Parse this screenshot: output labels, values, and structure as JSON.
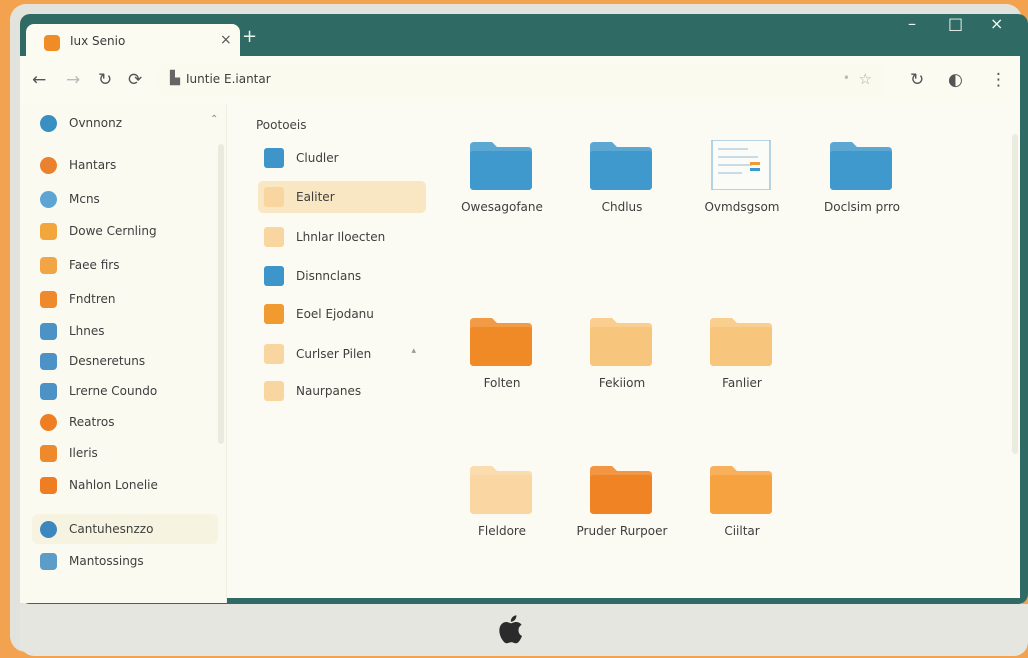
{
  "browser": {
    "tab_title": "Iux Senio",
    "tab_close": "×",
    "new_tab": "+",
    "window_controls": [
      "–",
      "□",
      "×"
    ],
    "nav_icons": [
      "←",
      "→",
      "↻",
      "⟳"
    ],
    "address": "Iuntie E.iantar",
    "right_icons": [
      "↻",
      "◐",
      "⋮"
    ]
  },
  "sidebar": {
    "items": [
      {
        "label": "Ovnnonz",
        "icon": "globe-icon",
        "color": "#3a8fc2"
      },
      {
        "label": "Hantars",
        "icon": "chrome-icon",
        "color": "#e9812f"
      },
      {
        "label": "Mcns",
        "icon": "globe-icon",
        "color": "#5fa5d4"
      },
      {
        "label": "Dowe Cernling",
        "icon": "folder-icon",
        "color": "#f2a63c"
      },
      {
        "label": "Faee firs",
        "icon": "folder-icon",
        "color": "#f1a544"
      },
      {
        "label": "Fndtren",
        "icon": "image-icon",
        "color": "#ef8a2c"
      },
      {
        "label": "Lhnes",
        "icon": "chart-icon",
        "color": "#4c92c6"
      },
      {
        "label": "Desneretuns",
        "icon": "monitor-icon",
        "color": "#4c92c6"
      },
      {
        "label": "Lrerne Coundo",
        "icon": "people-icon",
        "color": "#4c92c6"
      },
      {
        "label": "Reatros",
        "icon": "clock-icon",
        "color": "#ef7e23"
      },
      {
        "label": "Ileris",
        "icon": "folder-icon",
        "color": "#ef8a2c"
      },
      {
        "label": "Nahlon Lonelie",
        "icon": "app-icon",
        "color": "#ef7e23"
      },
      {
        "label": "Cantuhesnzzo",
        "icon": "settings-icon",
        "color": "#3d87bf"
      },
      {
        "label": "Mantossings",
        "icon": "user-icon",
        "color": "#5b9cc9"
      }
    ]
  },
  "midpane": {
    "heading": "Pootoeis",
    "items": [
      {
        "label": "Cludler",
        "color": "#3e95c9"
      },
      {
        "label": "Ealiter",
        "color": "#f9d6a0"
      },
      {
        "label": "Lhnlar Iloecten",
        "color": "#f9d6a0"
      },
      {
        "label": "Disnnclans",
        "color": "#3e95c9"
      },
      {
        "label": "Eoel Ejodanu",
        "color": "#f09a30"
      },
      {
        "label": "Curlser Pilen",
        "color": "#f9d6a0"
      },
      {
        "label": "Naurpanes",
        "color": "#f9d6a0"
      }
    ]
  },
  "grid": {
    "tiles": [
      {
        "label": "Owesagofane",
        "kind": "folder",
        "color": "#3f99cc"
      },
      {
        "label": "Chdlus",
        "kind": "folder",
        "color": "#3f99cc"
      },
      {
        "label": "Ovmdsgsom",
        "kind": "document",
        "color": "#3f99cc"
      },
      {
        "label": "Doclsim prro",
        "kind": "folder",
        "color": "#3f99cc"
      },
      {
        "label": "Folten",
        "kind": "folder",
        "color": "#f08a27"
      },
      {
        "label": "Fekiiom",
        "kind": "folder",
        "color": "#f8c57c"
      },
      {
        "label": "Fanlier",
        "kind": "folder",
        "color": "#f8c57c"
      },
      {
        "label": "Fleldore",
        "kind": "folder",
        "color": "#f9d6a2"
      },
      {
        "label": "Pruder Rurpoer",
        "kind": "folder",
        "color": "#f08424"
      },
      {
        "label": "Ciiltar",
        "kind": "folder",
        "color": "#f7a241"
      }
    ]
  }
}
